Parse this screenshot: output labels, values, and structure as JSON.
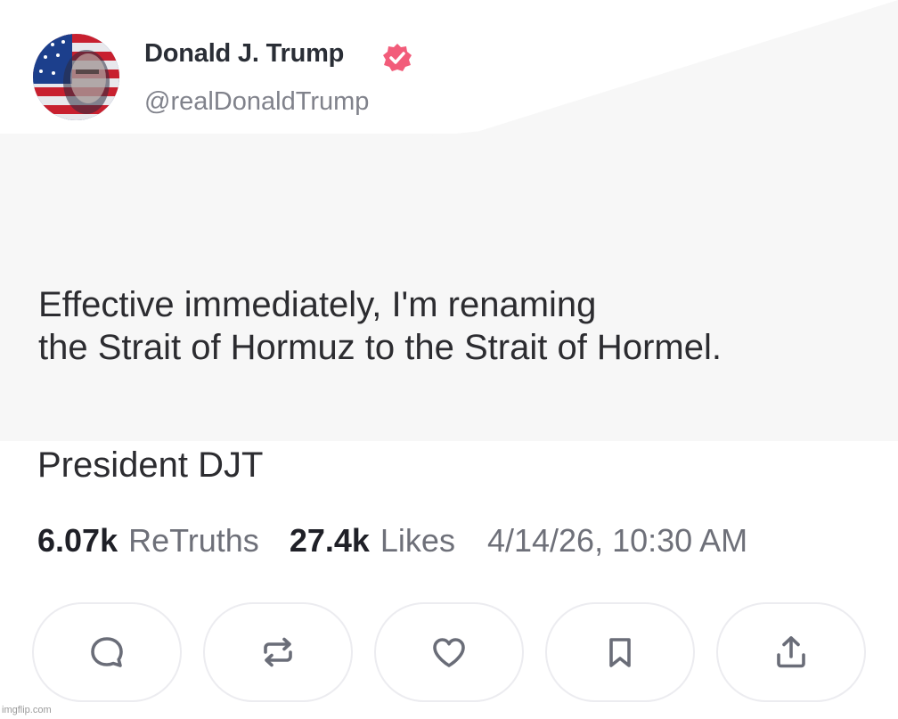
{
  "author": {
    "display_name": "Donald J. Trump",
    "handle": "@realDonaldTrump",
    "verified_color": "#f25c7a"
  },
  "post": {
    "text": "Effective immediately, I'm renaming\nthe Strait of Hormuz to the Strait of Hormel.",
    "signature": "President DJT"
  },
  "stats": {
    "retruths_count": "6.07k",
    "retruths_label": "ReTruths",
    "likes_count": "27.4k",
    "likes_label": "Likes",
    "timestamp": "4/14/26, 10:30 AM"
  },
  "actions": [
    {
      "icon": "reply-icon"
    },
    {
      "icon": "retruth-icon"
    },
    {
      "icon": "heart-icon"
    },
    {
      "icon": "bookmark-icon"
    },
    {
      "icon": "share-icon"
    }
  ],
  "watermark": "imgflip.com",
  "colors": {
    "icon_stroke": "#6a6d78",
    "button_border": "#ececf0"
  }
}
